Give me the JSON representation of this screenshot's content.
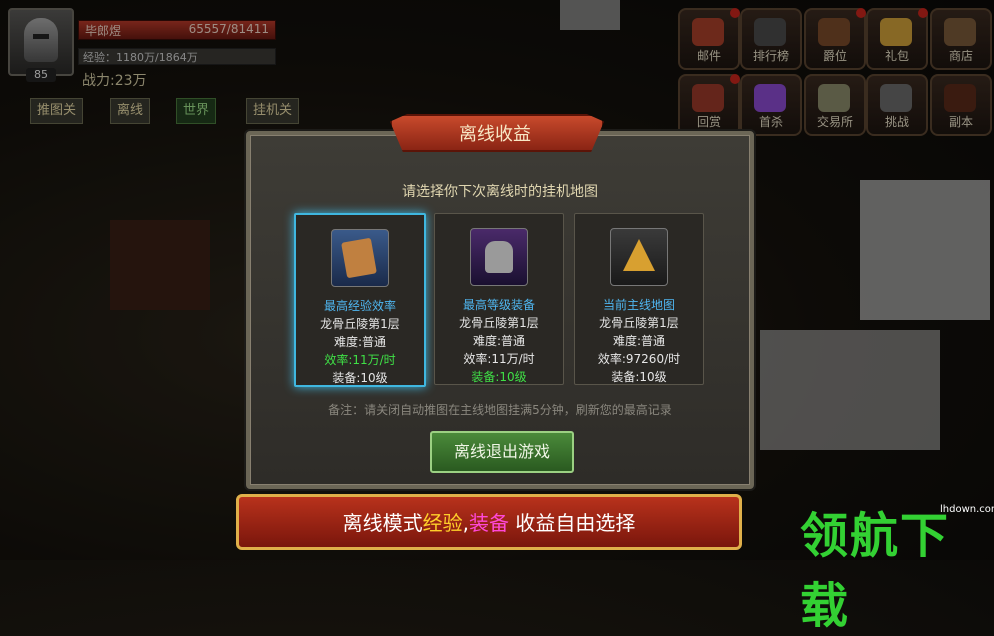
{
  "player": {
    "name": "毕郎煜",
    "hp": "65557/81411",
    "exp_label": "经验：1180万/1864万",
    "power_label": "战力:23万",
    "level": "85",
    "quick_buttons": [
      "推图关",
      "离线",
      "世界",
      "挂机关"
    ]
  },
  "menu_icons": [
    {
      "label": "邮件",
      "color": "#a8402a"
    },
    {
      "label": "排行榜",
      "color": "#4a4a4a"
    },
    {
      "label": "爵位",
      "color": "#7a4a2a"
    },
    {
      "label": "礼包",
      "color": "#d0a03a"
    },
    {
      "label": "商店",
      "color": "#7a5a3a"
    },
    {
      "label": "回赏",
      "color": "#9a3a2a"
    },
    {
      "label": "首杀",
      "color": "#8a4ad0"
    },
    {
      "label": "交易所",
      "color": "#8a8a6a"
    },
    {
      "label": "挑战",
      "color": "#6a6a6a"
    },
    {
      "label": "副本",
      "color": "#5a2a1a"
    }
  ],
  "dialog": {
    "title": "离线收益",
    "subtitle": "请选择你下次离线时的挂机地图",
    "cards": [
      {
        "title": "最高经验效率",
        "map": "龙骨丘陵第1层",
        "difficulty": "难度:普通",
        "efficiency": "效率:11万/时",
        "gear": "装备:10级",
        "icon": "book-icon"
      },
      {
        "title": "最高等级装备",
        "map": "龙骨丘陵第1层",
        "difficulty": "难度:普通",
        "efficiency": "效率:11万/时",
        "gear": "装备:10级",
        "icon": "armor-icon"
      },
      {
        "title": "当前主线地图",
        "map": "龙骨丘陵第1层",
        "difficulty": "难度:普通",
        "efficiency": "效率:97260/时",
        "gear": "装备:10级",
        "icon": "map-sigil-icon"
      }
    ],
    "note": "备注：请关闭自动推图在主线地图挂满5分钟，刷新您的最高记录",
    "exit_button": "离线退出游戏"
  },
  "banner": {
    "part1": "离线模式",
    "part2": "经验",
    "part3": ",",
    "part4": "装备",
    "part5": " 收益自由选择"
  },
  "watermark": {
    "text": "领航下载",
    "url": "lhdown.com"
  }
}
